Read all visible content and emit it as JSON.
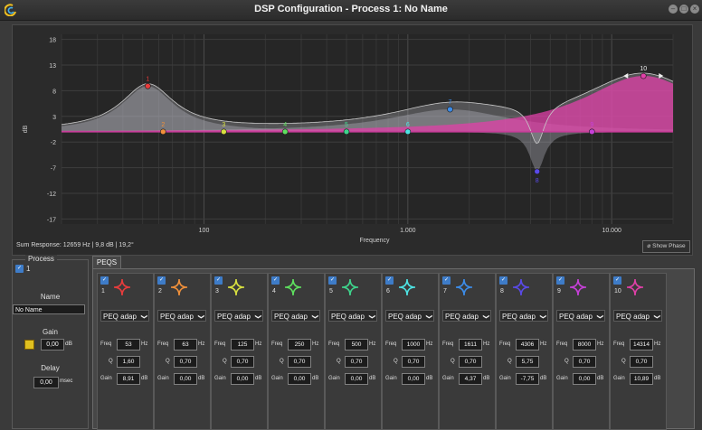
{
  "window": {
    "title": "DSP Configuration   -   Process 1: No Name"
  },
  "chart_data": {
    "type": "line",
    "ylabel": "dB",
    "xlabel": "Frequency",
    "xscale": "log",
    "xlim": [
      20,
      20000
    ],
    "ylim": [
      -18,
      19
    ],
    "yticks": [
      {
        "value": 18,
        "label": "18"
      },
      {
        "value": 13,
        "label": "13"
      },
      {
        "value": 8,
        "label": "8"
      },
      {
        "value": 3,
        "label": "3"
      },
      {
        "value": -2,
        "label": "-2"
      },
      {
        "value": -7,
        "label": "-7"
      },
      {
        "value": -12,
        "label": "-12"
      },
      {
        "value": -17,
        "label": "-17"
      }
    ],
    "xticks": [
      {
        "value": 100,
        "label": "100"
      },
      {
        "value": 1000,
        "label": "1.000"
      },
      {
        "value": 10000,
        "label": "10.000"
      }
    ],
    "grid": true,
    "filters": [
      {
        "label": "1",
        "freq": 53,
        "gain": 8.91,
        "q": 1.6,
        "color": "#e83c3c"
      },
      {
        "label": "2",
        "freq": 63,
        "gain": 0,
        "q": 0.7,
        "color": "#f0903a"
      },
      {
        "label": "3",
        "freq": 125,
        "gain": 0,
        "q": 0.7,
        "color": "#d8e040"
      },
      {
        "label": "4",
        "freq": 250,
        "gain": 0,
        "q": 0.7,
        "color": "#5ee05e"
      },
      {
        "label": "5",
        "freq": 500,
        "gain": 0,
        "q": 0.7,
        "color": "#3ed48c"
      },
      {
        "label": "6",
        "freq": 1000,
        "gain": 0,
        "q": 0.7,
        "color": "#4ee4e4"
      },
      {
        "label": "7",
        "freq": 1611,
        "gain": 4.37,
        "q": 0.7,
        "color": "#3c8ce8"
      },
      {
        "label": "8",
        "freq": 4306,
        "gain": -7.75,
        "q": 5.75,
        "color": "#5a4ae8"
      },
      {
        "label": "9",
        "freq": 8000,
        "gain": 0,
        "q": 0.7,
        "color": "#c640d8"
      },
      {
        "label": "10",
        "freq": 14314,
        "gain": 10.89,
        "q": 0.7,
        "color": "#e040a8"
      }
    ],
    "summary": "Sum Response: 12659 Hz  |  9,8 dB  |  19,2°"
  },
  "show_phase": "Show Phase",
  "process": {
    "legend": "Process",
    "number": "1",
    "name_label": "Name",
    "name_value": "No Name",
    "gain_label": "Gain",
    "gain_value": "0,00",
    "gain_unit": "dB",
    "delay_label": "Delay",
    "delay_value": "0,00",
    "delay_unit": "msec"
  },
  "tab": "PEQS",
  "labels": {
    "freq": "Freq",
    "q": "Q",
    "gain": "Gain",
    "hz": "Hz",
    "db": "dB"
  },
  "peqs": [
    {
      "num": "1",
      "type": "PEQ adap",
      "freq": "53",
      "q": "1,60",
      "gain": "8,91",
      "color": "#e83c3c"
    },
    {
      "num": "2",
      "type": "PEQ adap",
      "freq": "63",
      "q": "0,70",
      "gain": "0,00",
      "color": "#f0903a"
    },
    {
      "num": "3",
      "type": "PEQ adap",
      "freq": "125",
      "q": "0,70",
      "gain": "0,00",
      "color": "#d8e040"
    },
    {
      "num": "4",
      "type": "PEQ adap",
      "freq": "250",
      "q": "0,70",
      "gain": "0,00",
      "color": "#5ee05e"
    },
    {
      "num": "5",
      "type": "PEQ adap",
      "freq": "500",
      "q": "0,70",
      "gain": "0,00",
      "color": "#3ed48c"
    },
    {
      "num": "6",
      "type": "PEQ adap",
      "freq": "1000",
      "q": "0,70",
      "gain": "0,00",
      "color": "#4ee4e4"
    },
    {
      "num": "7",
      "type": "PEQ adap",
      "freq": "1611",
      "q": "0,70",
      "gain": "4,37",
      "color": "#3c8ce8"
    },
    {
      "num": "8",
      "type": "PEQ adap",
      "freq": "4306",
      "q": "5,75",
      "gain": "-7,75",
      "color": "#5a4ae8"
    },
    {
      "num": "9",
      "type": "PEQ adap",
      "freq": "8000",
      "q": "0,70",
      "gain": "0,00",
      "color": "#c640d8"
    },
    {
      "num": "10",
      "type": "PEQ adap",
      "freq": "14314",
      "q": "0,70",
      "gain": "10,89",
      "color": "#e040a8"
    }
  ]
}
